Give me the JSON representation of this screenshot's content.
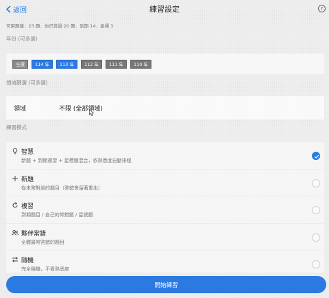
{
  "nav": {
    "back_label": "返回",
    "title": "練習設定",
    "help_label": "?"
  },
  "info_text": "可用題庫：23 題．你已答過 20 題．到期 14．星標 3",
  "year_section": {
    "label": "年份 (可多選)",
    "chips": [
      {
        "label": "全選",
        "selected": false
      },
      {
        "label": "114 年",
        "selected": true
      },
      {
        "label": "113 年",
        "selected": true
      },
      {
        "label": "112 年",
        "selected": false
      },
      {
        "label": "111 年",
        "selected": false
      },
      {
        "label": "110 年",
        "selected": false
      }
    ]
  },
  "domain_section": {
    "label": "領域篩選 (可多選)",
    "row_label": "領域",
    "row_value": "不限 (全部領域)"
  },
  "mode_section": {
    "label": "練習模式",
    "modes": [
      {
        "icon": "lightbulb-icon",
        "title": "智慧",
        "desc": "新題 + 到期複習 + 星標題混合，依熟悉度自動排程",
        "checked": true
      },
      {
        "icon": "plus-icon",
        "title": "新題",
        "desc": "從未答對過的題目（答錯會留著重出）",
        "checked": false
      },
      {
        "icon": "refresh-icon",
        "title": "複習",
        "desc": "到期題目 / 自己的常錯題 / 星號題",
        "checked": false
      },
      {
        "icon": "people-icon",
        "title": "夥伴常錯",
        "desc": "全體最常答錯的題目",
        "checked": false
      },
      {
        "icon": "shuffle-icon",
        "title": "隨機",
        "desc": "完全隨機，不看熟悉度",
        "checked": false
      }
    ]
  },
  "start_button": "開始練習",
  "colors": {
    "accent": "#2a7ae2",
    "chip_gray": "#777777"
  }
}
